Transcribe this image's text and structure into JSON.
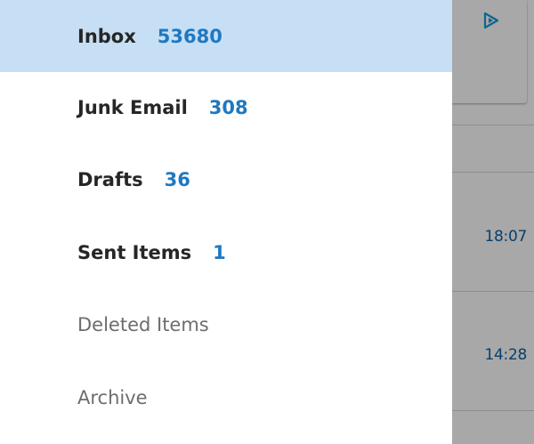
{
  "folders": [
    {
      "name": "Inbox",
      "count": "53680",
      "selected": true,
      "unread": true
    },
    {
      "name": "Junk Email",
      "count": "308",
      "selected": false,
      "unread": true
    },
    {
      "name": "Drafts",
      "count": "36",
      "selected": false,
      "unread": true
    },
    {
      "name": "Sent Items",
      "count": "1",
      "selected": false,
      "unread": true
    },
    {
      "name": "Deleted Items",
      "count": "",
      "selected": false,
      "unread": false
    },
    {
      "name": "Archive",
      "count": "",
      "selected": false,
      "unread": false
    }
  ],
  "background_list": {
    "times": [
      "18:07",
      "14:28"
    ],
    "icon": "play-icon"
  },
  "colors": {
    "selected_bg": "#c7dff4",
    "count_text": "#1f78c1",
    "time_text": "#0f5ea8",
    "icon_color": "#1a9ad6"
  }
}
